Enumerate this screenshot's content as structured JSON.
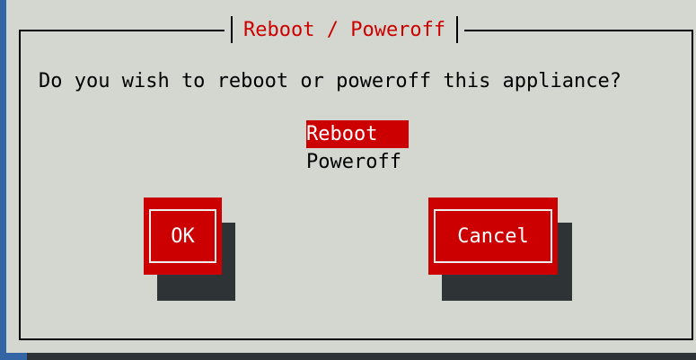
{
  "dialog": {
    "title": "Reboot / Poweroff",
    "question": "Do you wish to reboot or poweroff this appliance?",
    "options": [
      {
        "label": "Reboot",
        "selected": true
      },
      {
        "label": "Poweroff",
        "selected": false
      }
    ],
    "buttons": {
      "ok": "OK",
      "cancel": "Cancel"
    }
  },
  "colors": {
    "background": "#3465a4",
    "dialog": "#d3d7cf",
    "accent": "#cc0000",
    "shadow": "#2e3436"
  }
}
